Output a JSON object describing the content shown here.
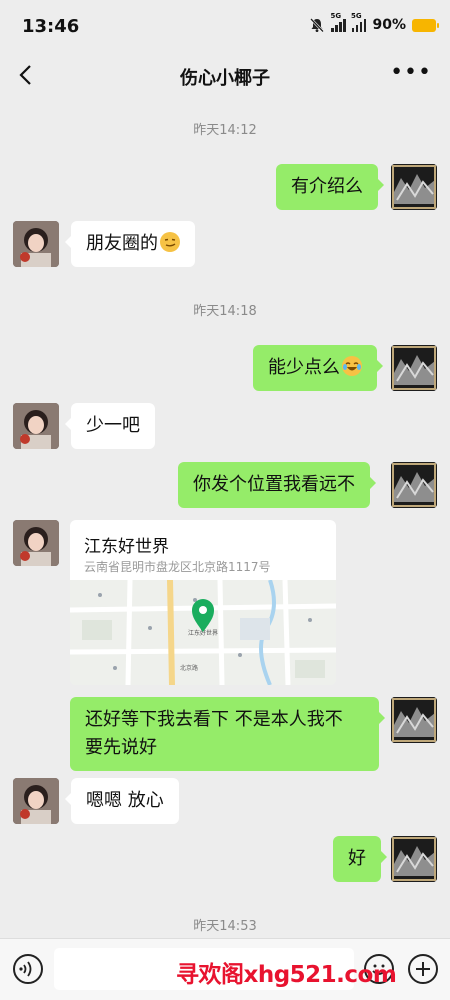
{
  "status_bar": {
    "time": "13:46",
    "battery": "90%",
    "signal_1": "5G",
    "signal_2": "5G"
  },
  "header": {
    "title": "伤心小椰子"
  },
  "timestamps": [
    "昨天14:12",
    "昨天14:18",
    "昨天14:53"
  ],
  "messages": [
    {
      "side": "me",
      "text": "有介绍么"
    },
    {
      "side": "other",
      "text": "朋友圈的"
    },
    {
      "side": "me",
      "text": "能少点么"
    },
    {
      "side": "other",
      "text": "少一吧"
    },
    {
      "side": "me",
      "text": "你发个位置我看远不"
    },
    {
      "side": "other",
      "text": "嗯嗯 放心"
    },
    {
      "side": "me",
      "text": "好"
    }
  ],
  "long_message": {
    "line1": "还好等下我去看下  不是本人我不",
    "line2": "要先说好"
  },
  "location": {
    "title": "江东好世界",
    "address": "云南省昆明市盘龙区北京路1117号"
  },
  "map_labels": {
    "road": "北京路",
    "place": "江东好世界"
  },
  "watermark": "寻欢阁xhg521.com",
  "colors": {
    "my_bubble": "#95ec69",
    "other_bubble": "#ffffff",
    "background": "#ededed",
    "watermark": "#e8132f",
    "battery": "#f7b500",
    "pin": "#1aad5e"
  }
}
